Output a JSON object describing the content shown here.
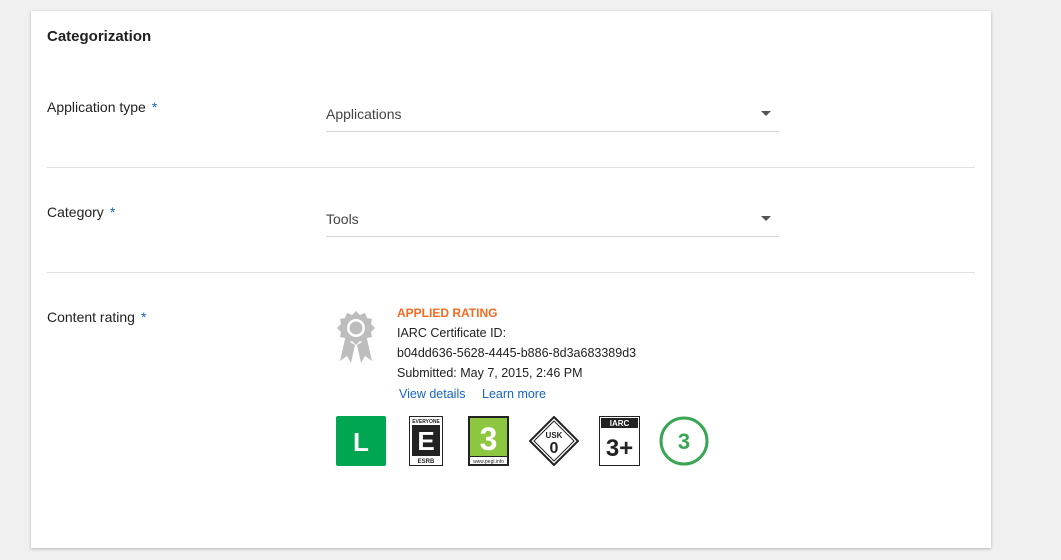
{
  "card": {
    "title": "Categorization"
  },
  "application_type": {
    "label": "Application type",
    "required_mark": "*",
    "value": "Applications"
  },
  "category": {
    "label": "Category",
    "required_mark": "*",
    "value": "Tools"
  },
  "content_rating": {
    "label": "Content rating",
    "required_mark": "*",
    "applied_rating_heading": "APPLIED RATING",
    "certificate_label": "IARC Certificate ID:",
    "certificate_id": "b04dd636-5628-4445-b886-8d3a683389d3",
    "submitted": "Submitted: May 7, 2015, 2:46 PM",
    "view_details": "View details",
    "learn_more": "Learn more",
    "badges": [
      {
        "name": "classind-l",
        "text": "L",
        "color": "#00a651"
      },
      {
        "name": "esrb-everyone",
        "top_text": "EVERYONE",
        "text": "E",
        "bottom_text": "ESRB"
      },
      {
        "name": "pegi-3",
        "text": "3",
        "bottom_text": "www.pegi.info",
        "color": "#8dc63f"
      },
      {
        "name": "usk-0",
        "top_text": "USK",
        "text": "0"
      },
      {
        "name": "iarc-3plus",
        "top_text": "IARC",
        "text": "3+"
      },
      {
        "name": "generic-3",
        "text": "3",
        "color": "#3aa654"
      }
    ]
  },
  "colors": {
    "accent_link": "#1565c0",
    "applied_rating": "#f36b21"
  }
}
